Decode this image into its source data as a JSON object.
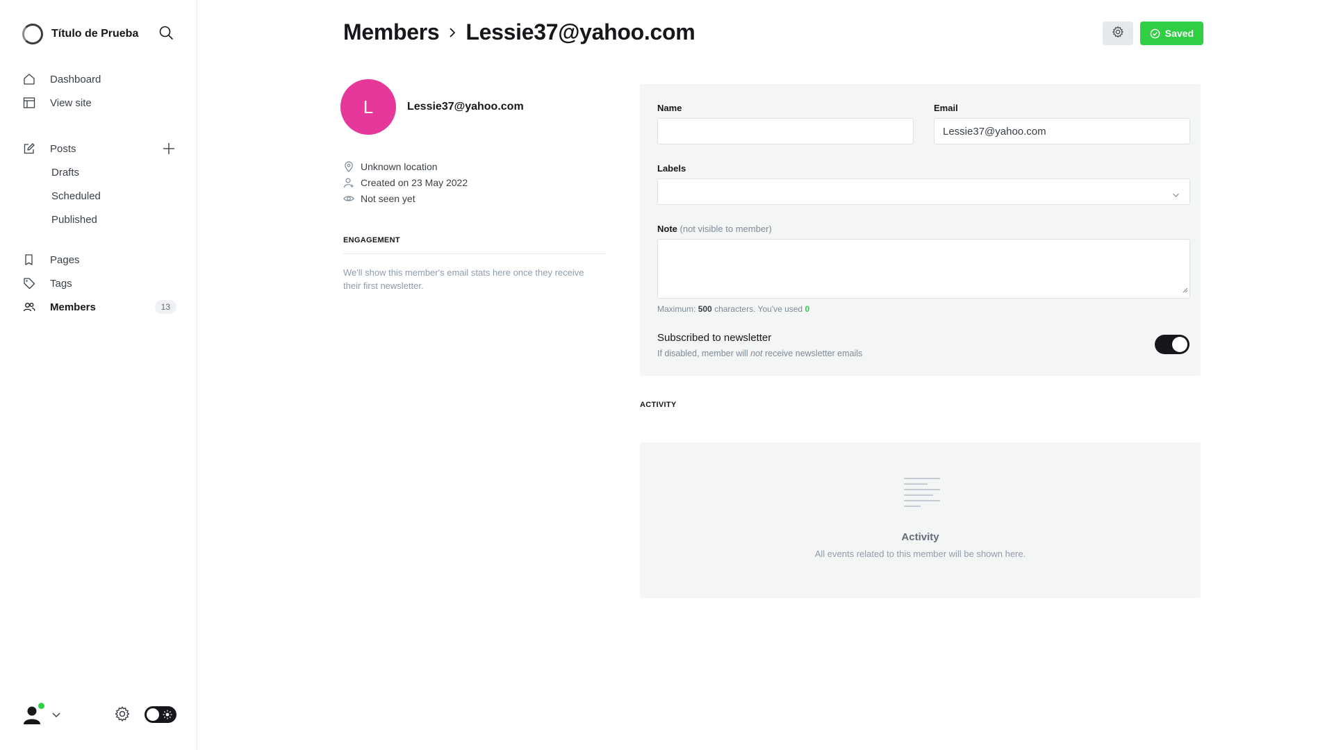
{
  "site": {
    "title": "Título de Prueba"
  },
  "nav": {
    "dashboard": "Dashboard",
    "view_site": "View site",
    "posts": "Posts",
    "drafts": "Drafts",
    "scheduled": "Scheduled",
    "published": "Published",
    "pages": "Pages",
    "tags": "Tags",
    "members": "Members",
    "members_count": "13"
  },
  "header": {
    "breadcrumb_parent": "Members",
    "breadcrumb_current": "Lessie37@yahoo.com",
    "saved_label": "Saved"
  },
  "member": {
    "avatar_initial": "L",
    "avatar_color": "#e5389a",
    "email": "Lessie37@yahoo.com",
    "location": "Unknown location",
    "created": "Created on 23 May 2022",
    "last_seen": "Not seen yet"
  },
  "engagement": {
    "title": "ENGAGEMENT",
    "text": "We'll show this member's email stats here once they receive their first newsletter."
  },
  "form": {
    "name_label": "Name",
    "name_value": "",
    "email_label": "Email",
    "email_value": "Lessie37@yahoo.com",
    "labels_label": "Labels",
    "labels_value": "",
    "note_label": "Note",
    "note_hint": "(not visible to member)",
    "note_value": "",
    "counter_prefix": "Maximum:",
    "counter_max": "500",
    "counter_middle": "characters. You've used",
    "counter_used": "0",
    "newsletter_title": "Subscribed to newsletter",
    "newsletter_desc_start": "If disabled, member will",
    "newsletter_desc_em": "not",
    "newsletter_desc_end": "receive newsletter emails",
    "newsletter_enabled": true
  },
  "activity": {
    "section_title": "ACTIVITY",
    "heading": "Activity",
    "description": "All events related to this member will be shown here."
  },
  "colors": {
    "accent_green": "#30cf43",
    "dark": "#15171a"
  }
}
